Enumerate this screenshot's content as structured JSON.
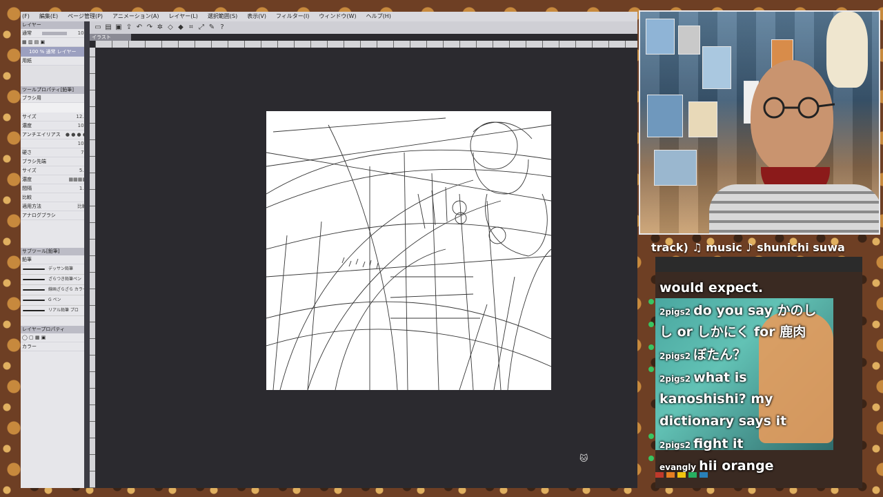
{
  "menu": [
    "(F)",
    "編集(E)",
    "ページ管理(P)",
    "アニメーション(A)",
    "レイヤー(L)",
    "選択範囲(S)",
    "表示(V)",
    "フィルター(I)",
    "ウィンドウ(W)",
    "ヘルプ(H)"
  ],
  "doc_tab": "イラスト",
  "layers": {
    "header": "レイヤー",
    "blend_mode": "通常",
    "opacity": "100",
    "layer1": "100 % 通常 レイヤー",
    "layer2": "用紙"
  },
  "tool_property": {
    "header": "ツールプロパティ[鉛筆]",
    "tool_name": "ブラシ用",
    "rows": [
      {
        "label": "サイズ",
        "value": "12.5"
      },
      {
        "label": "濃度",
        "value": "100"
      },
      {
        "label": "アンチエイリアス",
        "value": ""
      },
      {
        "label": "",
        "value": "101"
      },
      {
        "label": "硬さ",
        "value": "79"
      },
      {
        "label": "ブラシ先端",
        "value": ""
      },
      {
        "label": "サイズ",
        "value": "5.0"
      },
      {
        "label": "濃度",
        "value": ""
      },
      {
        "label": "間隔",
        "value": "1.0"
      }
    ],
    "mode_label": "比較",
    "method_label": "比較",
    "brush_label": "アナログブラシ",
    "apply_label": "適用方法"
  },
  "subtool": {
    "header": "サブツール[鉛筆]",
    "active_tab": "鉛筆",
    "brushes": [
      "デッサン鉛筆",
      "ざらつき鉛筆ペン",
      "線画ざらざら カラー",
      "G ペン",
      "リアル鉛筆 プロ"
    ]
  },
  "layer_property": "レイヤープロパティ",
  "color_label": "カラー",
  "ticker": "track)  ♫ music ♪ shunichi suwa",
  "chat": [
    {
      "user": "",
      "text": "would expect."
    },
    {
      "user": "2pigs2",
      "text": "do you say かのし"
    },
    {
      "user": "",
      "text": "し or しかにく for 鹿肉"
    },
    {
      "user": "2pigs2",
      "text": "ぼたん？"
    },
    {
      "user": "2pigs2",
      "text": "what is"
    },
    {
      "user": "",
      "text": "kanoshishi? my"
    },
    {
      "user": "",
      "text": "dictionary says it"
    },
    {
      "user": "2pigs2",
      "text": "fight it"
    },
    {
      "user": "evangly",
      "text": "hii orange"
    }
  ]
}
